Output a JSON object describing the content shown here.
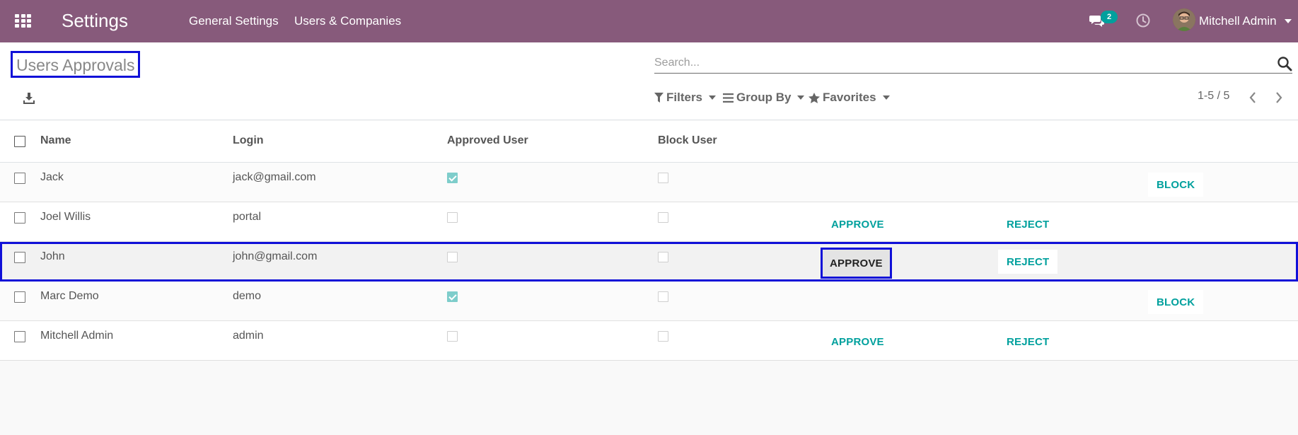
{
  "app": {
    "title": "Settings",
    "menu": [
      "General Settings",
      "Users & Companies"
    ],
    "messages_count": "2",
    "user_name": "Mitchell Admin"
  },
  "control": {
    "page_title": "Users Approvals",
    "search_placeholder": "Search...",
    "filters_label": "Filters",
    "group_by_label": "Group By",
    "favorites_label": "Favorites",
    "pager": "1-5 / 5"
  },
  "table": {
    "columns": [
      "Name",
      "Login",
      "Approved User",
      "Block User"
    ],
    "rows": [
      {
        "name": "Jack",
        "login": "jack@gmail.com",
        "approved": true,
        "blocked": false,
        "approve": "",
        "reject": "",
        "block": "BLOCK"
      },
      {
        "name": "Joel Willis",
        "login": "portal",
        "approved": false,
        "blocked": false,
        "approve": "APPROVE",
        "reject": "REJECT",
        "block": ""
      },
      {
        "name": "John",
        "login": "john@gmail.com",
        "approved": false,
        "blocked": false,
        "approve": "APPROVE",
        "reject": "REJECT",
        "block": ""
      },
      {
        "name": "Marc Demo",
        "login": "demo",
        "approved": true,
        "blocked": false,
        "approve": "",
        "reject": "",
        "block": "BLOCK"
      },
      {
        "name": "Mitchell Admin",
        "login": "admin",
        "approved": false,
        "blocked": false,
        "approve": "APPROVE",
        "reject": "REJECT",
        "block": ""
      }
    ]
  },
  "colors": {
    "navbar": "#875a7b",
    "accent": "#00a09d",
    "highlight_border": "#1010d8"
  },
  "icons": [
    "apps-icon",
    "chat-icon",
    "clock-icon",
    "download-icon",
    "search-icon",
    "filter-icon",
    "group-by-icon",
    "star-icon",
    "chevron-left-icon",
    "chevron-right-icon"
  ]
}
